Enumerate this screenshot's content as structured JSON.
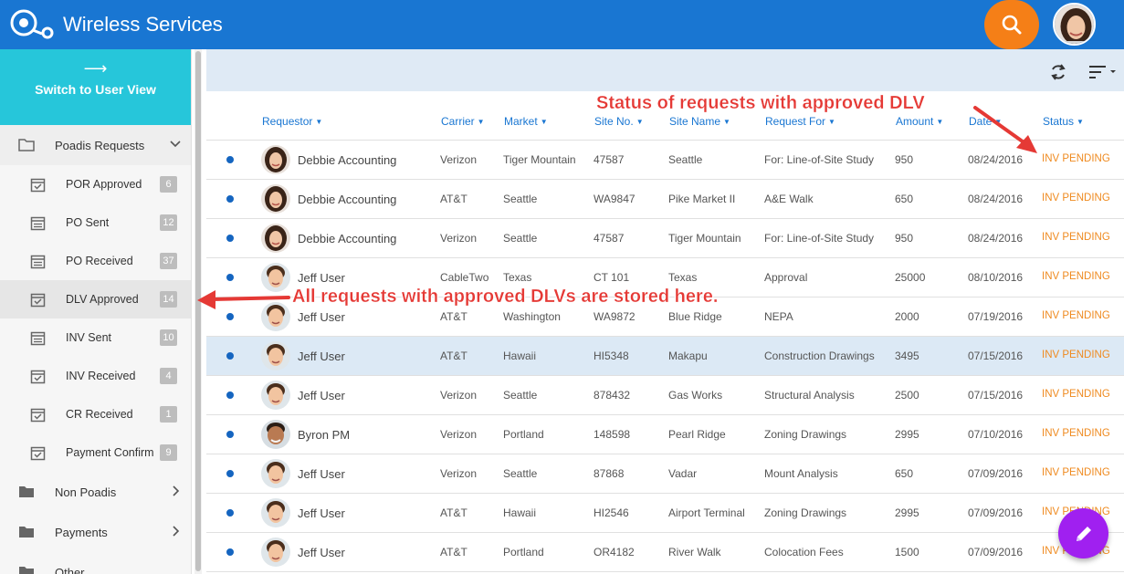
{
  "app": {
    "title": "Wireless Services"
  },
  "sidebar": {
    "switch_label": "Switch to User View",
    "groups": [
      {
        "label": "Poadis Requests",
        "open": true
      },
      {
        "label": "Non Poadis"
      },
      {
        "label": "Payments"
      },
      {
        "label": "Other"
      }
    ],
    "items": [
      {
        "label": "POR Approved",
        "count": "6"
      },
      {
        "label": "PO Sent",
        "count": "12"
      },
      {
        "label": "PO Received",
        "count": "37"
      },
      {
        "label": "DLV Approved",
        "count": "14"
      },
      {
        "label": "INV Sent",
        "count": "10"
      },
      {
        "label": "INV Received",
        "count": "4"
      },
      {
        "label": "CR Received",
        "count": "1"
      },
      {
        "label": "Payment Confirm",
        "count": "9"
      }
    ]
  },
  "table": {
    "headers": {
      "requestor": "Requestor",
      "carrier": "Carrier",
      "market": "Market",
      "site_no": "Site No.",
      "site_name": "Site Name",
      "request_for": "Request For",
      "amount": "Amount",
      "date": "Date",
      "status": "Status"
    },
    "rows": [
      {
        "requestor": "Debbie Accounting",
        "carrier": "Verizon",
        "market": "Tiger Mountain",
        "site_no": "47587",
        "site_name": "Seattle",
        "request_for": "For: Line-of-Site Study",
        "amount": "950",
        "date": "08/24/2016",
        "status": "INV PENDING",
        "avatar": "female"
      },
      {
        "requestor": "Debbie Accounting",
        "carrier": "AT&T",
        "market": "Seattle",
        "site_no": "WA9847",
        "site_name": "Pike Market II",
        "request_for": "A&E Walk",
        "amount": "650",
        "date": "08/24/2016",
        "status": "INV PENDING",
        "avatar": "female"
      },
      {
        "requestor": "Debbie Accounting",
        "carrier": "Verizon",
        "market": "Seattle",
        "site_no": "47587",
        "site_name": "Tiger Mountain",
        "request_for": "For: Line-of-Site Study",
        "amount": "950",
        "date": "08/24/2016",
        "status": "INV PENDING",
        "avatar": "female"
      },
      {
        "requestor": "Jeff User",
        "carrier": "CableTwo",
        "market": "Texas",
        "site_no": "CT 101",
        "site_name": "Texas",
        "request_for": "Approval",
        "amount": "25000",
        "date": "08/10/2016",
        "status": "INV PENDING",
        "avatar": "male"
      },
      {
        "requestor": "Jeff User",
        "carrier": "AT&T",
        "market": "Washington",
        "site_no": "WA9872",
        "site_name": "Blue Ridge",
        "request_for": "NEPA",
        "amount": "2000",
        "date": "07/19/2016",
        "status": "INV PENDING",
        "avatar": "male"
      },
      {
        "requestor": "Jeff User",
        "carrier": "AT&T",
        "market": "Hawaii",
        "site_no": "HI5348",
        "site_name": "Makapu",
        "request_for": "Construction Drawings",
        "amount": "3495",
        "date": "07/15/2016",
        "status": "INV PENDING",
        "avatar": "male"
      },
      {
        "requestor": "Jeff User",
        "carrier": "Verizon",
        "market": "Seattle",
        "site_no": "878432",
        "site_name": "Gas Works",
        "request_for": "Structural Analysis",
        "amount": "2500",
        "date": "07/15/2016",
        "status": "INV PENDING",
        "avatar": "male"
      },
      {
        "requestor": "Byron PM",
        "carrier": "Verizon",
        "market": "Portland",
        "site_no": "148598",
        "site_name": "Pearl Ridge",
        "request_for": "Zoning Drawings",
        "amount": "2995",
        "date": "07/10/2016",
        "status": "INV PENDING",
        "avatar": "male2"
      },
      {
        "requestor": "Jeff User",
        "carrier": "Verizon",
        "market": "Seattle",
        "site_no": "87868",
        "site_name": "Vadar",
        "request_for": "Mount Analysis",
        "amount": "650",
        "date": "07/09/2016",
        "status": "INV PENDING",
        "avatar": "male"
      },
      {
        "requestor": "Jeff User",
        "carrier": "AT&T",
        "market": "Hawaii",
        "site_no": "HI2546",
        "site_name": "Airport Terminal",
        "request_for": "Zoning Drawings",
        "amount": "2995",
        "date": "07/09/2016",
        "status": "INV PENDING",
        "avatar": "male"
      },
      {
        "requestor": "Jeff User",
        "carrier": "AT&T",
        "market": "Portland",
        "site_no": "OR4182",
        "site_name": "River Walk",
        "request_for": "Colocation Fees",
        "amount": "1500",
        "date": "07/09/2016",
        "status": "INV PENDING",
        "avatar": "male"
      }
    ]
  },
  "annotations": {
    "status_note": "Status of requests with approved DLV",
    "dlv_note": "All requests with approved DLVs are stored here."
  },
  "colors": {
    "topbar": "#1976d2",
    "accent_cyan": "#26c6da",
    "search_orange": "#f57f17",
    "status_orange": "#ef8a1f",
    "fab_purple": "#a020f0",
    "annotation_red": "#e53935"
  }
}
